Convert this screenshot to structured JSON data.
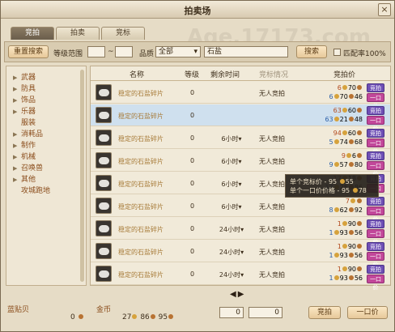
{
  "window": {
    "title": "拍卖场",
    "close": "×"
  },
  "tabs": [
    {
      "label": "竞拍"
    },
    {
      "label": "拍卖"
    },
    {
      "label": "竞标"
    }
  ],
  "search": {
    "reset_label": "重置搜索",
    "level_label": "等级范围",
    "level_sep": "~",
    "quality_label": "品质",
    "quality_value": "全部",
    "keyword_value": "石盐",
    "search_label": "搜索",
    "match_label": "匹配率100%"
  },
  "sidebar": {
    "items": [
      {
        "label": "武器",
        "arrow": "▶"
      },
      {
        "label": "防具",
        "arrow": "▶"
      },
      {
        "label": "饰品",
        "arrow": "▶"
      },
      {
        "label": "乐器",
        "arrow": "▶"
      },
      {
        "label": "服装",
        "arrow": ""
      },
      {
        "label": "消耗品",
        "arrow": "▶"
      },
      {
        "label": "制作",
        "arrow": "▶"
      },
      {
        "label": "机械",
        "arrow": "▶"
      },
      {
        "label": "召唤兽",
        "arrow": "▶"
      },
      {
        "label": "其他",
        "arrow": "▶"
      },
      {
        "label": "攻城跑地",
        "arrow": ""
      }
    ]
  },
  "table": {
    "headers": {
      "name": "名称",
      "level": "等级",
      "time": "剩余时间",
      "status": "竞标情况",
      "price": "竞拍价"
    },
    "rows": [
      {
        "name": "稳定的石盐碎片",
        "level": "0",
        "time": "",
        "status": "无人竞拍",
        "p1": "6",
        "p1b": "70",
        "p2": "6",
        "p2b": "70",
        "p2c": "46",
        "bid": "竞拍",
        "buy": "一口价"
      },
      {
        "name": "稳定的石盐碎片",
        "level": "0",
        "time": "",
        "status": "",
        "p1": "63",
        "p1b": "60",
        "p2": "63",
        "p2b": "21",
        "p2c": "48",
        "p0": "60",
        "bid": "竞拍",
        "buy": "一口价"
      },
      {
        "name": "稳定的石盐碎片",
        "level": "0",
        "time": "6小时▾",
        "status": "无人竞拍",
        "p1": "94",
        "p1b": "60",
        "p2": "5",
        "p2b": "74",
        "p2c": "68",
        "bid": "竞拍",
        "buy": "一口价"
      },
      {
        "name": "稳定的石盐碎片",
        "level": "0",
        "time": "6小时▾",
        "status": "无人竞拍",
        "p1": "9",
        "p1b": "6",
        "p2": "9",
        "p2b": "57",
        "p2c": "80",
        "p0": "80",
        "bid": "竞拍",
        "buy": "一口价"
      },
      {
        "name": "稳定的石盐碎片",
        "level": "0",
        "time": "6小时▾",
        "status": "无人竞拍",
        "p1": "17",
        "p1b": "18",
        "p2": "17",
        "p2b": "25",
        "p2c": "86",
        "p0": "80",
        "bid": "竞拍",
        "buy": "一口价"
      },
      {
        "name": "稳定的石盐碎片",
        "level": "0",
        "time": "6小时▾",
        "status": "无人竞拍",
        "p1": "7",
        "p1b": "",
        "p2": "8",
        "p2b": "62",
        "p2c": "92",
        "p0": "96",
        "bid": "竞拍",
        "buy": "一口价"
      },
      {
        "name": "稳定的石盐碎片",
        "level": "0",
        "time": "24小时▾",
        "status": "无人竞拍",
        "p1": "1",
        "p1b": "90",
        "p2": "1",
        "p2b": "93",
        "p2c": "56",
        "p0": "20",
        "bid": "竞拍",
        "buy": "一口价"
      },
      {
        "name": "稳定的石盐碎片",
        "level": "0",
        "time": "24小时▾",
        "status": "无人竞拍",
        "p1": "1",
        "p1b": "90",
        "p2": "1",
        "p2b": "93",
        "p2c": "56",
        "p0": "20",
        "bid": "竞拍",
        "buy": "一口价"
      },
      {
        "name": "稳定的石盐碎片",
        "level": "0",
        "time": "24小时▾",
        "status": "无人竞拍",
        "p1": "1",
        "p1b": "90",
        "p2": "1",
        "p2b": "93",
        "p2c": "56",
        "p0": "20",
        "bid": "竞拍",
        "buy": "一口价"
      }
    ]
  },
  "tooltip": {
    "line1": "单个竞标价 - 95",
    "line1b": "55",
    "line2": "单个一口价价格 - 95",
    "line2b": "78"
  },
  "pager": {
    "prev": "◀",
    "next": "▶"
  },
  "footer": {
    "shells_label": "蓝贴贝",
    "shells_value": "0",
    "gold_label": "金币",
    "gold_a": "27",
    "gold_b": "86",
    "gold_c": "95",
    "bid_input": "0",
    "buy_input": "0",
    "bid_label": "竞拍",
    "buy_label": "一口价"
  },
  "watermark": {
    "url": "Age.17173.com",
    "zone": "上古世纪专区"
  }
}
